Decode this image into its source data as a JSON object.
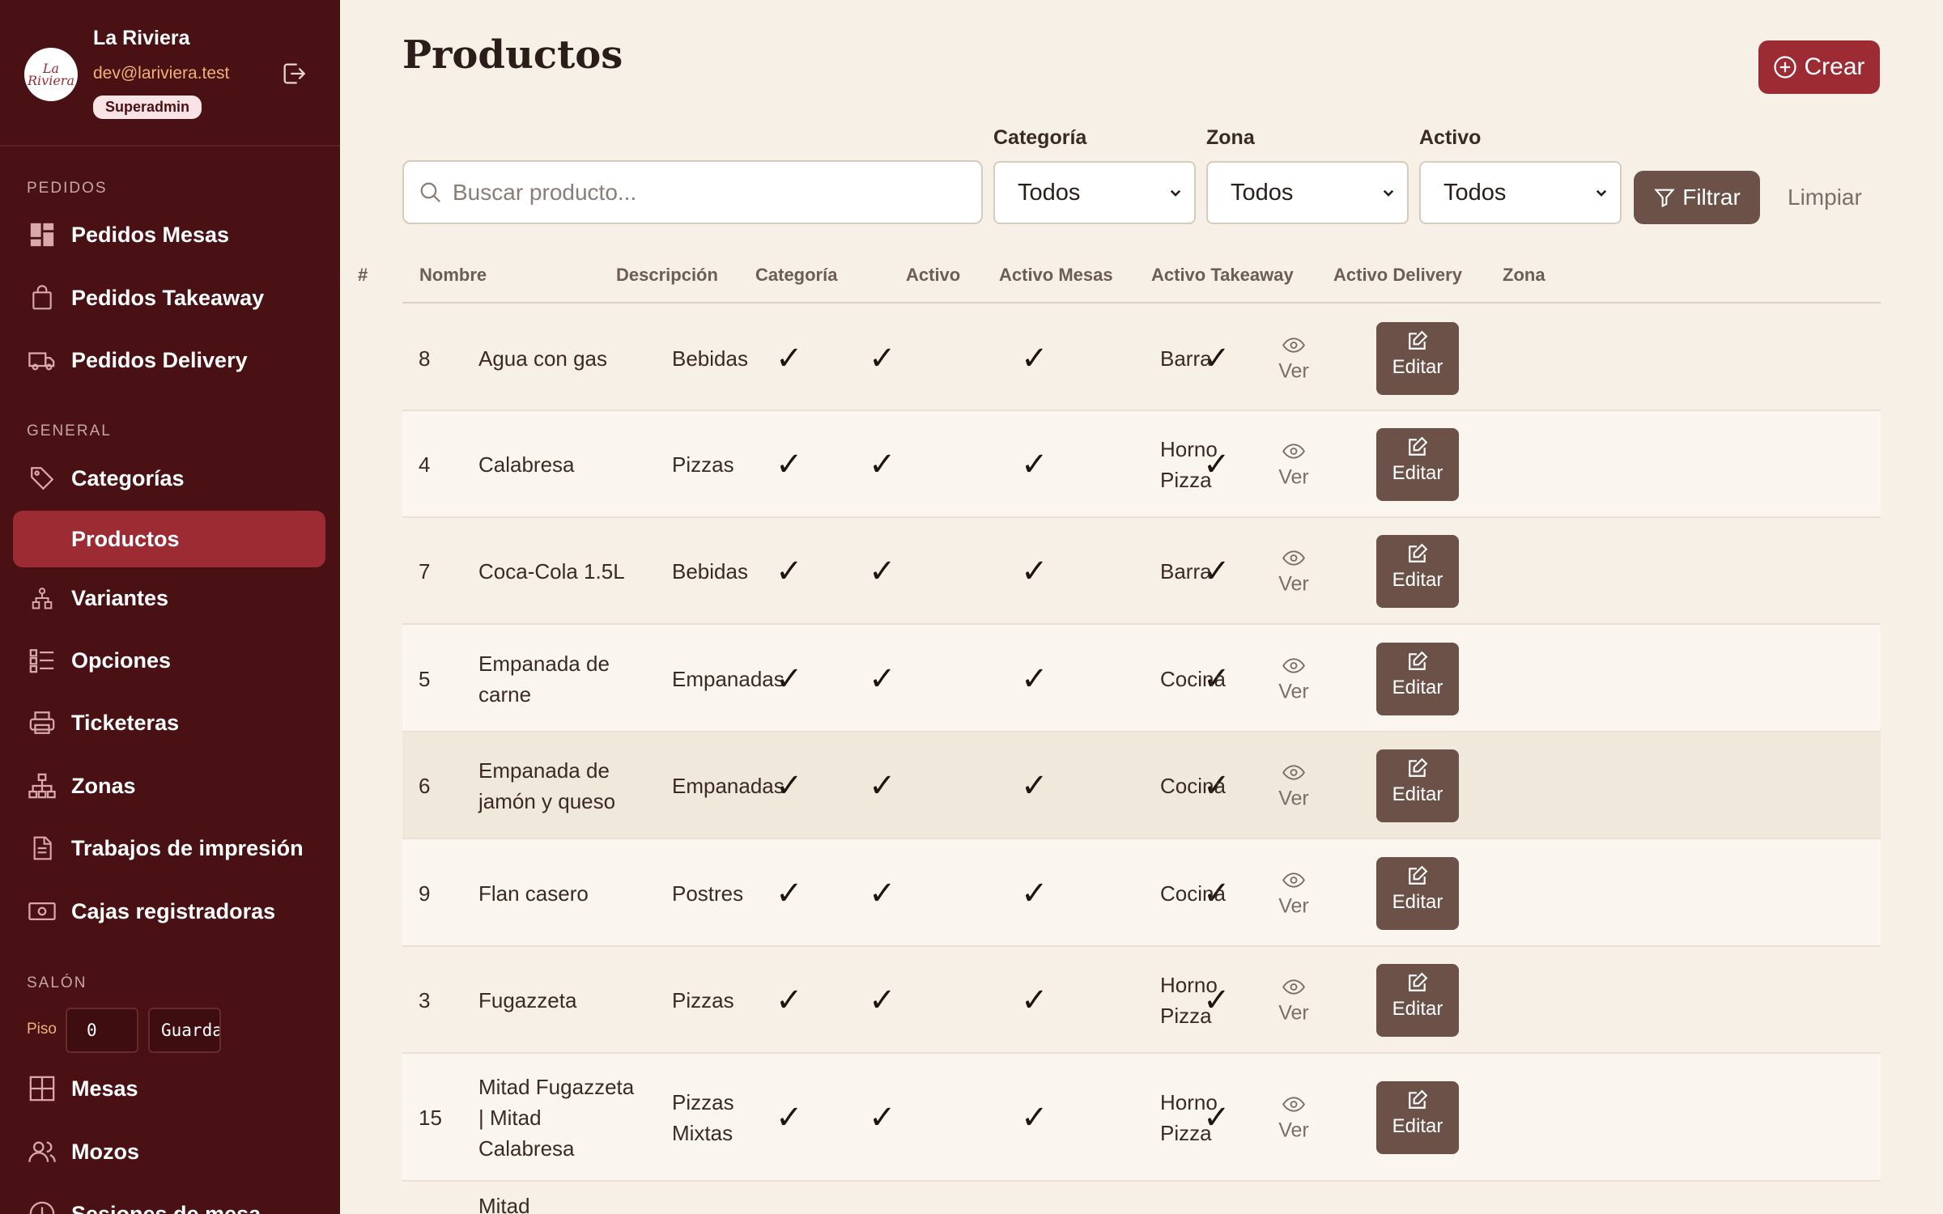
{
  "sidebar": {
    "logo_text": "La Riviera",
    "user_name": "La Riviera",
    "user_email": "dev@lariviera.test",
    "user_role": "Superadmin",
    "sections": {
      "pedidos": "PEDIDOS",
      "general": "GENERAL",
      "salon": "SALÓN"
    },
    "items": [
      {
        "label": "Pedidos Mesas",
        "icon": "dashboard-icon"
      },
      {
        "label": "Pedidos Takeaway",
        "icon": "shopping-bag-icon"
      },
      {
        "label": "Pedidos Delivery",
        "icon": "truck-icon"
      },
      {
        "label": "Categorías",
        "icon": "tag-icon"
      },
      {
        "label": "Productos",
        "icon": "",
        "active": true
      },
      {
        "label": "Variantes",
        "icon": "hierarchy-icon"
      },
      {
        "label": "Opciones",
        "icon": "checklist-icon"
      },
      {
        "label": "Ticketeras",
        "icon": "printer-icon"
      },
      {
        "label": "Zonas",
        "icon": "sitemap-icon"
      },
      {
        "label": "Trabajos de impresión",
        "icon": "document-icon"
      },
      {
        "label": "Cajas registradoras",
        "icon": "cash-icon"
      },
      {
        "label": "Mesas",
        "icon": "grid-icon"
      },
      {
        "label": "Mozos",
        "icon": "users-icon"
      },
      {
        "label": "Sesiones de mesa",
        "icon": "clock-icon"
      }
    ],
    "piso_label": "Piso",
    "piso_value": "0",
    "guardar_label": "Guardar"
  },
  "header": {
    "title": "Productos",
    "create_label": "Crear"
  },
  "filters": {
    "search_placeholder": "Buscar producto...",
    "categoria_label": "Categoría",
    "categoria_value": "Todos",
    "zona_label": "Zona",
    "zona_value": "Todos",
    "activo_label": "Activo",
    "activo_value": "Todos",
    "filtrar_label": "Filtrar",
    "limpiar_label": "Limpiar"
  },
  "table": {
    "columns": [
      "#",
      "Nombre",
      "Descripción",
      "Categoría",
      "Activo",
      "Activo Mesas",
      "Activo Takeaway",
      "Activo Delivery",
      "Zona"
    ],
    "view_label": "Ver",
    "edit_label": "Editar",
    "check_mark": "✓",
    "rows": [
      {
        "id": "8",
        "name": [
          "Agua con gas"
        ],
        "category": [
          "Bebidas"
        ],
        "zone": [
          "Barra"
        ]
      },
      {
        "id": "4",
        "name": [
          "Calabresa"
        ],
        "category": [
          "Pizzas"
        ],
        "zone": [
          "Horno",
          "Pizza"
        ]
      },
      {
        "id": "7",
        "name": [
          "Coca-Cola 1.5L"
        ],
        "category": [
          "Bebidas"
        ],
        "zone": [
          "Barra"
        ]
      },
      {
        "id": "5",
        "name": [
          "Empanada de",
          "carne"
        ],
        "category": [
          "Empanadas"
        ],
        "zone": [
          "Cocina"
        ]
      },
      {
        "id": "6",
        "name": [
          "Empanada de",
          "jamón y queso"
        ],
        "category": [
          "Empanadas"
        ],
        "zone": [
          "Cocina"
        ]
      },
      {
        "id": "9",
        "name": [
          "Flan casero"
        ],
        "category": [
          "Postres"
        ],
        "zone": [
          "Cocina"
        ]
      },
      {
        "id": "3",
        "name": [
          "Fugazzeta"
        ],
        "category": [
          "Pizzas"
        ],
        "zone": [
          "Horno",
          "Pizza"
        ]
      },
      {
        "id": "15",
        "name": [
          "Mitad Fugazzeta",
          "| Mitad",
          "Calabresa"
        ],
        "category": [
          "Pizzas",
          "Mixtas"
        ],
        "zone": [
          "Horno",
          "Pizza"
        ]
      },
      {
        "id": "",
        "name": [
          "Mitad"
        ],
        "category": [
          ""
        ],
        "zone": [
          ""
        ]
      }
    ]
  }
}
